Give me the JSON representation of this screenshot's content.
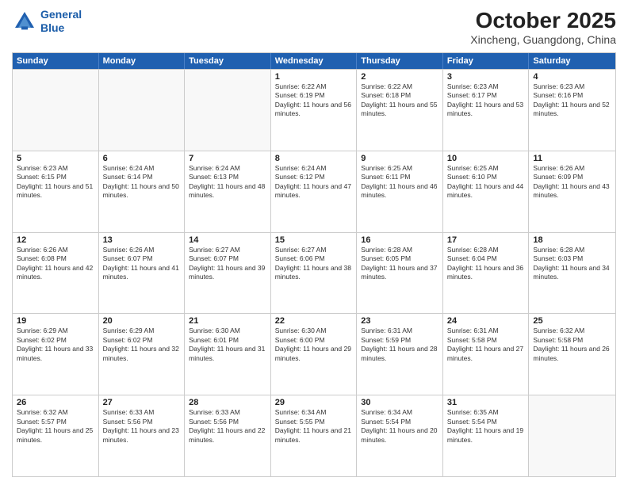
{
  "header": {
    "logo_line1": "General",
    "logo_line2": "Blue",
    "main_title": "October 2025",
    "subtitle": "Xincheng, Guangdong, China"
  },
  "weekdays": [
    "Sunday",
    "Monday",
    "Tuesday",
    "Wednesday",
    "Thursday",
    "Friday",
    "Saturday"
  ],
  "rows": [
    [
      {
        "day": "",
        "sunrise": "",
        "sunset": "",
        "daylight": ""
      },
      {
        "day": "",
        "sunrise": "",
        "sunset": "",
        "daylight": ""
      },
      {
        "day": "",
        "sunrise": "",
        "sunset": "",
        "daylight": ""
      },
      {
        "day": "1",
        "sunrise": "Sunrise: 6:22 AM",
        "sunset": "Sunset: 6:19 PM",
        "daylight": "Daylight: 11 hours and 56 minutes."
      },
      {
        "day": "2",
        "sunrise": "Sunrise: 6:22 AM",
        "sunset": "Sunset: 6:18 PM",
        "daylight": "Daylight: 11 hours and 55 minutes."
      },
      {
        "day": "3",
        "sunrise": "Sunrise: 6:23 AM",
        "sunset": "Sunset: 6:17 PM",
        "daylight": "Daylight: 11 hours and 53 minutes."
      },
      {
        "day": "4",
        "sunrise": "Sunrise: 6:23 AM",
        "sunset": "Sunset: 6:16 PM",
        "daylight": "Daylight: 11 hours and 52 minutes."
      }
    ],
    [
      {
        "day": "5",
        "sunrise": "Sunrise: 6:23 AM",
        "sunset": "Sunset: 6:15 PM",
        "daylight": "Daylight: 11 hours and 51 minutes."
      },
      {
        "day": "6",
        "sunrise": "Sunrise: 6:24 AM",
        "sunset": "Sunset: 6:14 PM",
        "daylight": "Daylight: 11 hours and 50 minutes."
      },
      {
        "day": "7",
        "sunrise": "Sunrise: 6:24 AM",
        "sunset": "Sunset: 6:13 PM",
        "daylight": "Daylight: 11 hours and 48 minutes."
      },
      {
        "day": "8",
        "sunrise": "Sunrise: 6:24 AM",
        "sunset": "Sunset: 6:12 PM",
        "daylight": "Daylight: 11 hours and 47 minutes."
      },
      {
        "day": "9",
        "sunrise": "Sunrise: 6:25 AM",
        "sunset": "Sunset: 6:11 PM",
        "daylight": "Daylight: 11 hours and 46 minutes."
      },
      {
        "day": "10",
        "sunrise": "Sunrise: 6:25 AM",
        "sunset": "Sunset: 6:10 PM",
        "daylight": "Daylight: 11 hours and 44 minutes."
      },
      {
        "day": "11",
        "sunrise": "Sunrise: 6:26 AM",
        "sunset": "Sunset: 6:09 PM",
        "daylight": "Daylight: 11 hours and 43 minutes."
      }
    ],
    [
      {
        "day": "12",
        "sunrise": "Sunrise: 6:26 AM",
        "sunset": "Sunset: 6:08 PM",
        "daylight": "Daylight: 11 hours and 42 minutes."
      },
      {
        "day": "13",
        "sunrise": "Sunrise: 6:26 AM",
        "sunset": "Sunset: 6:07 PM",
        "daylight": "Daylight: 11 hours and 41 minutes."
      },
      {
        "day": "14",
        "sunrise": "Sunrise: 6:27 AM",
        "sunset": "Sunset: 6:07 PM",
        "daylight": "Daylight: 11 hours and 39 minutes."
      },
      {
        "day": "15",
        "sunrise": "Sunrise: 6:27 AM",
        "sunset": "Sunset: 6:06 PM",
        "daylight": "Daylight: 11 hours and 38 minutes."
      },
      {
        "day": "16",
        "sunrise": "Sunrise: 6:28 AM",
        "sunset": "Sunset: 6:05 PM",
        "daylight": "Daylight: 11 hours and 37 minutes."
      },
      {
        "day": "17",
        "sunrise": "Sunrise: 6:28 AM",
        "sunset": "Sunset: 6:04 PM",
        "daylight": "Daylight: 11 hours and 36 minutes."
      },
      {
        "day": "18",
        "sunrise": "Sunrise: 6:28 AM",
        "sunset": "Sunset: 6:03 PM",
        "daylight": "Daylight: 11 hours and 34 minutes."
      }
    ],
    [
      {
        "day": "19",
        "sunrise": "Sunrise: 6:29 AM",
        "sunset": "Sunset: 6:02 PM",
        "daylight": "Daylight: 11 hours and 33 minutes."
      },
      {
        "day": "20",
        "sunrise": "Sunrise: 6:29 AM",
        "sunset": "Sunset: 6:02 PM",
        "daylight": "Daylight: 11 hours and 32 minutes."
      },
      {
        "day": "21",
        "sunrise": "Sunrise: 6:30 AM",
        "sunset": "Sunset: 6:01 PM",
        "daylight": "Daylight: 11 hours and 31 minutes."
      },
      {
        "day": "22",
        "sunrise": "Sunrise: 6:30 AM",
        "sunset": "Sunset: 6:00 PM",
        "daylight": "Daylight: 11 hours and 29 minutes."
      },
      {
        "day": "23",
        "sunrise": "Sunrise: 6:31 AM",
        "sunset": "Sunset: 5:59 PM",
        "daylight": "Daylight: 11 hours and 28 minutes."
      },
      {
        "day": "24",
        "sunrise": "Sunrise: 6:31 AM",
        "sunset": "Sunset: 5:58 PM",
        "daylight": "Daylight: 11 hours and 27 minutes."
      },
      {
        "day": "25",
        "sunrise": "Sunrise: 6:32 AM",
        "sunset": "Sunset: 5:58 PM",
        "daylight": "Daylight: 11 hours and 26 minutes."
      }
    ],
    [
      {
        "day": "26",
        "sunrise": "Sunrise: 6:32 AM",
        "sunset": "Sunset: 5:57 PM",
        "daylight": "Daylight: 11 hours and 25 minutes."
      },
      {
        "day": "27",
        "sunrise": "Sunrise: 6:33 AM",
        "sunset": "Sunset: 5:56 PM",
        "daylight": "Daylight: 11 hours and 23 minutes."
      },
      {
        "day": "28",
        "sunrise": "Sunrise: 6:33 AM",
        "sunset": "Sunset: 5:56 PM",
        "daylight": "Daylight: 11 hours and 22 minutes."
      },
      {
        "day": "29",
        "sunrise": "Sunrise: 6:34 AM",
        "sunset": "Sunset: 5:55 PM",
        "daylight": "Daylight: 11 hours and 21 minutes."
      },
      {
        "day": "30",
        "sunrise": "Sunrise: 6:34 AM",
        "sunset": "Sunset: 5:54 PM",
        "daylight": "Daylight: 11 hours and 20 minutes."
      },
      {
        "day": "31",
        "sunrise": "Sunrise: 6:35 AM",
        "sunset": "Sunset: 5:54 PM",
        "daylight": "Daylight: 11 hours and 19 minutes."
      },
      {
        "day": "",
        "sunrise": "",
        "sunset": "",
        "daylight": ""
      }
    ]
  ]
}
